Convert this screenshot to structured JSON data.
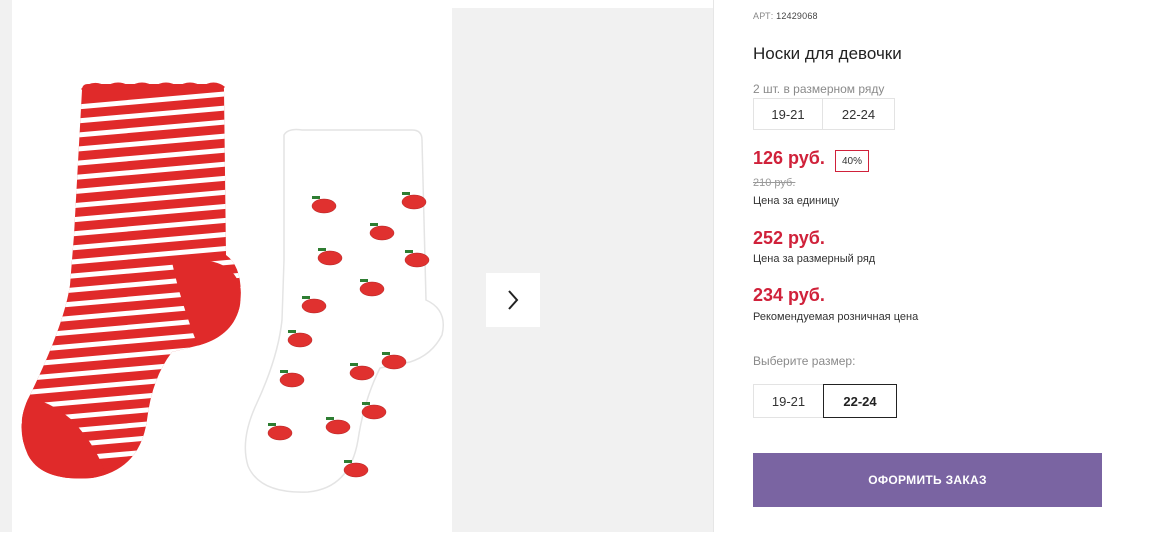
{
  "gallery": {
    "next_icon": "chevron-right-icon"
  },
  "product": {
    "article_label": "АРТ:",
    "article_number": "12429068",
    "title": "Носки для девочки",
    "pack_info": "2 шт. в размерном ряду",
    "pack_sizes": [
      "19-21",
      "22-24"
    ],
    "price": "126 руб.",
    "discount": "40%",
    "old_price": "210 руб.",
    "unit_label": "Цена за единицу",
    "row_price": "252 руб.",
    "row_label": "Цена за размерный ряд",
    "retail_price": "234 руб.",
    "retail_label": "Рекомендуемая розничная цена",
    "choose_size_label": "Выберите размер:",
    "size_options": [
      "19-21",
      "22-24"
    ],
    "selected_size": "22-24",
    "order_button": "ОФОРМИТЬ ЗАКАЗ"
  },
  "colors": {
    "price_red": "#d0213a",
    "order_button_bg": "#7a64a2"
  }
}
